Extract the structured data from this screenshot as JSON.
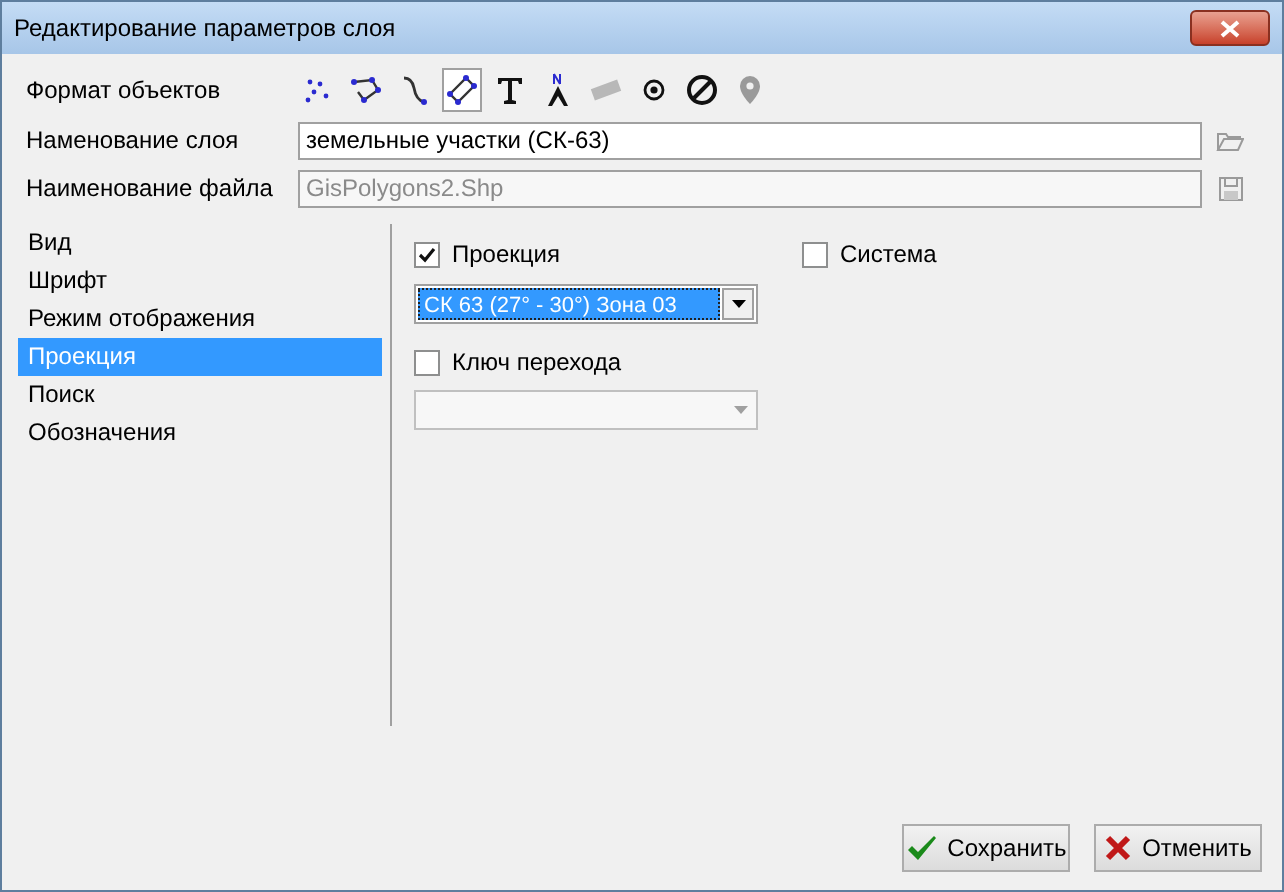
{
  "window": {
    "title": "Редактирование параметров слоя"
  },
  "format": {
    "label": "Формат объектов",
    "icons": [
      {
        "kind": "points",
        "selected": false
      },
      {
        "kind": "polyline",
        "selected": false
      },
      {
        "kind": "curve",
        "selected": false
      },
      {
        "kind": "polygon",
        "selected": true
      },
      {
        "kind": "text",
        "selected": false
      },
      {
        "kind": "north",
        "selected": false
      },
      {
        "kind": "ruler",
        "selected": false
      },
      {
        "kind": "dot",
        "selected": false
      },
      {
        "kind": "nosign",
        "selected": false
      },
      {
        "kind": "pin",
        "selected": false
      }
    ]
  },
  "layer_name": {
    "label": "Наменование слоя",
    "value": "земельные участки (СК-63)",
    "disabled": false
  },
  "file_name": {
    "label": "Наименование файла",
    "value": "GisPolygons2.Shp",
    "disabled": true
  },
  "sidebar": {
    "items": [
      {
        "label": "Вид",
        "selected": false
      },
      {
        "label": "Шрифт",
        "selected": false
      },
      {
        "label": "Режим отображения",
        "selected": false
      },
      {
        "label": "Проекция",
        "selected": true
      },
      {
        "label": "Поиск",
        "selected": false
      },
      {
        "label": "Обозначения",
        "selected": false
      }
    ]
  },
  "projection": {
    "checkbox": {
      "label": "Проекция",
      "checked": true
    },
    "system": {
      "label": "Система",
      "checked": false
    },
    "combo": {
      "value": "СК 63 (27° - 30°) Зона 03",
      "disabled": false
    },
    "key_checkbox": {
      "label": "Ключ перехода",
      "checked": false
    },
    "key_combo": {
      "disabled": true
    }
  },
  "buttons": [
    {
      "kind": "save",
      "label": "Сохранить"
    },
    {
      "kind": "cancel",
      "label": "Отменить"
    }
  ]
}
